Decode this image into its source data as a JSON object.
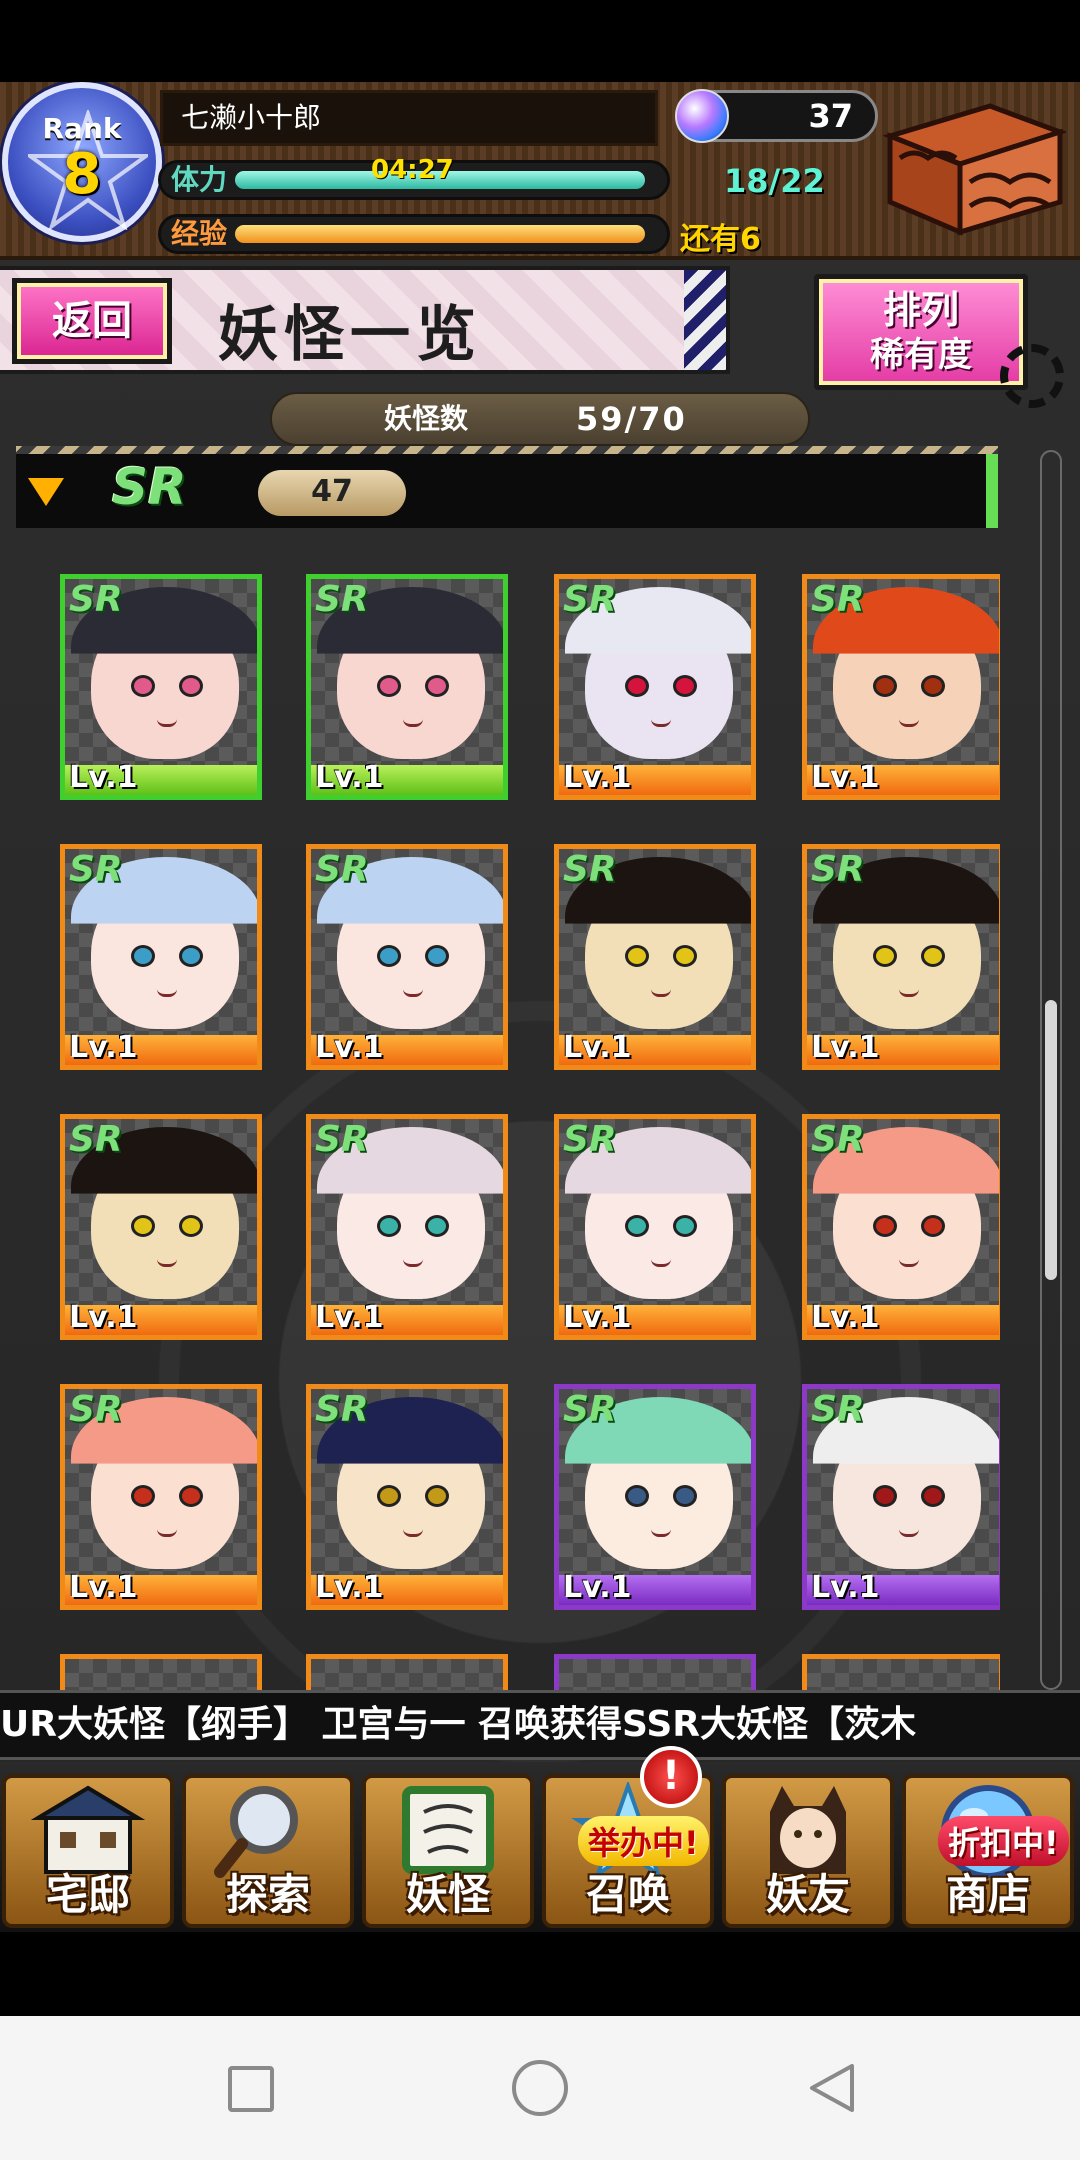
{
  "header": {
    "rank_label": "Rank",
    "rank": "8",
    "player_name": "七濑小十郎",
    "stamina_label": "体力",
    "stamina_timer": "04:27",
    "stamina_count": "18/22",
    "stamina_fill": 0.82,
    "exp_label": "经验",
    "exp_remaining": "还有6",
    "exp_fill": 0.82,
    "gems": "37"
  },
  "title_row": {
    "back_label": "返回",
    "page_title": "妖怪一览",
    "sort_label_1": "排列",
    "sort_label_2": "稀有度"
  },
  "collection": {
    "label": "妖怪数",
    "value": "59/70"
  },
  "category": {
    "rarity": "SR",
    "count": "47"
  },
  "cards": [
    {
      "tag": "SR",
      "level": "Lv.1",
      "frame": "green",
      "hair": "#2b2b35",
      "skin": "#f7d7cf",
      "eye": "#e05a8a"
    },
    {
      "tag": "SR",
      "level": "Lv.1",
      "frame": "green",
      "hair": "#2b2b35",
      "skin": "#f7d7cf",
      "eye": "#e05a8a"
    },
    {
      "tag": "SR",
      "level": "Lv.1",
      "frame": "orange",
      "hair": "#e8e8f2",
      "skin": "#e9e3f2",
      "eye": "#d4143c"
    },
    {
      "tag": "SR",
      "level": "Lv.1",
      "frame": "orange",
      "hair": "#e04a1a",
      "skin": "#f6d3b8",
      "eye": "#a03010"
    },
    {
      "tag": "SR",
      "level": "Lv.1",
      "frame": "orange",
      "hair": "#bcd3f2",
      "skin": "#fbe5df",
      "eye": "#3c9ec6"
    },
    {
      "tag": "SR",
      "level": "Lv.1",
      "frame": "orange",
      "hair": "#bcd3f2",
      "skin": "#fbe5df",
      "eye": "#3c9ec6"
    },
    {
      "tag": "SR",
      "level": "Lv.1",
      "frame": "orange",
      "hair": "#1c1410",
      "skin": "#f2dfb8",
      "eye": "#e2c418"
    },
    {
      "tag": "SR",
      "level": "Lv.1",
      "frame": "orange",
      "hair": "#1c1410",
      "skin": "#f2dfb8",
      "eye": "#e2c418"
    },
    {
      "tag": "SR",
      "level": "Lv.1",
      "frame": "orange",
      "hair": "#1c1410",
      "skin": "#f2dfb8",
      "eye": "#e2c418"
    },
    {
      "tag": "SR",
      "level": "Lv.1",
      "frame": "orange",
      "hair": "#e6d8e0",
      "skin": "#fbe9e6",
      "eye": "#3ab2a8"
    },
    {
      "tag": "SR",
      "level": "Lv.1",
      "frame": "orange",
      "hair": "#e6d8e0",
      "skin": "#fbe9e6",
      "eye": "#3ab2a8"
    },
    {
      "tag": "SR",
      "level": "Lv.1",
      "frame": "orange",
      "hair": "#f59a86",
      "skin": "#fbe0d2",
      "eye": "#c4301c"
    },
    {
      "tag": "SR",
      "level": "Lv.1",
      "frame": "orange",
      "hair": "#f59a86",
      "skin": "#fbe0d2",
      "eye": "#c4301c"
    },
    {
      "tag": "SR",
      "level": "Lv.1",
      "frame": "orange",
      "hair": "#1d2250",
      "skin": "#f7e3c8",
      "eye": "#c29a18"
    },
    {
      "tag": "SR",
      "level": "Lv.1",
      "frame": "purple",
      "hair": "#7fd8b6",
      "skin": "#fbecdf",
      "eye": "#3a5a86"
    },
    {
      "tag": "SR",
      "level": "Lv.1",
      "frame": "purple",
      "hair": "#eeeeee",
      "skin": "#f7e6de",
      "eye": "#a01818"
    }
  ],
  "ticker": {
    "text": "UR大妖怪【纲手】        卫宫与一  召唤获得SSR大妖怪【茨木"
  },
  "nav": [
    {
      "label": "宅邸",
      "icon": "mansion-icon",
      "badge": "",
      "notify": ""
    },
    {
      "label": "探索",
      "icon": "magnifier-icon",
      "badge": "",
      "notify": ""
    },
    {
      "label": "妖怪",
      "icon": "scroll-icon",
      "badge": "",
      "notify": ""
    },
    {
      "label": "召唤",
      "icon": "summon-icon",
      "badge": "举办中!",
      "notify": "!"
    },
    {
      "label": "妖友",
      "icon": "friend-icon",
      "badge": "",
      "notify": ""
    },
    {
      "label": "商店",
      "icon": "shop-orb-icon",
      "badge": "折扣中!",
      "notify": ""
    }
  ],
  "colors": {
    "frame_orange": "#f08a18",
    "frame_green": "#3fcf2e",
    "frame_purple": "#8c39c8",
    "accent_pink": "#e33aa4",
    "sr_green": "#7ee07a"
  }
}
